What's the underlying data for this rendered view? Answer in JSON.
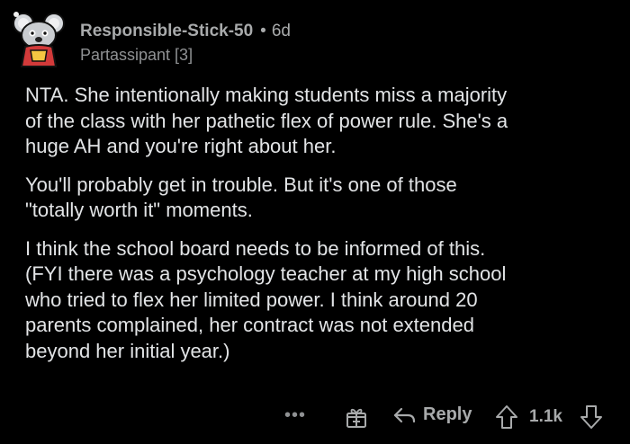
{
  "comment": {
    "author": "Responsible-Stick-50",
    "separator": "•",
    "age": "6d",
    "flair": "Partassipant [3]",
    "paragraphs": [
      "NTA. She intentionally making students miss a majority\nof the class with her pathetic flex of power rule. She's a\nhuge AH and you're right about her.",
      "You'll probably get in trouble. But it's one of those\n\"totally worth it\" moments.",
      "I think the school board needs to be informed of this.\n(FYI there was a psychology teacher at my high school\nwho tried to flex her limited power. I think around 20\nparents complained, her contract was not extended\nbeyond her initial year.)"
    ]
  },
  "actions": {
    "more_label": "•••",
    "reply_label": "Reply",
    "score": "1.1k",
    "award_icon": "gift-icon",
    "reply_icon": "reply-arrow-icon",
    "upvote_icon": "upvote-arrow-icon",
    "downvote_icon": "downvote-arrow-icon"
  },
  "colors": {
    "background": "#000000",
    "text": "#e2e4e6",
    "muted": "#a8aaab"
  }
}
